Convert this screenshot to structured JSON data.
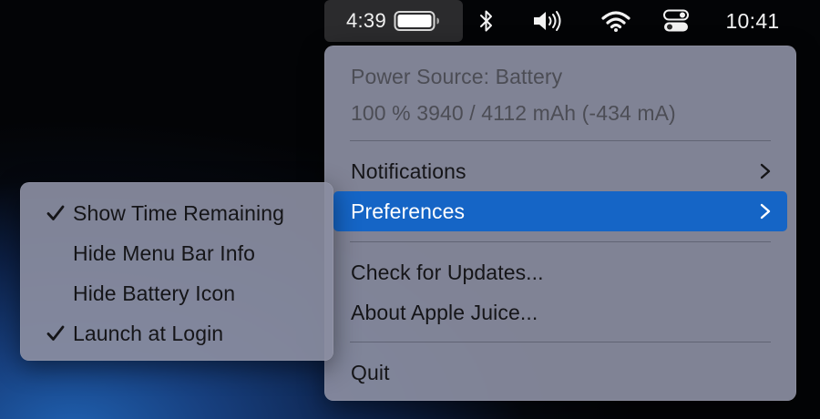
{
  "menubar": {
    "battery_time": "4:39",
    "battery_level_percent": 100,
    "clock": "10:41",
    "icons": [
      "battery-icon",
      "bluetooth-icon",
      "volume-icon",
      "wifi-icon",
      "control-center-icon"
    ]
  },
  "main_menu": {
    "power_source": "Power Source: Battery",
    "capacity": "100 % 3940 / 4112 mAh (-434 mA)",
    "notifications": "Notifications",
    "preferences": "Preferences",
    "check_updates": "Check for Updates...",
    "about": "About Apple Juice...",
    "quit": "Quit"
  },
  "preferences_submenu": {
    "items": [
      {
        "label": "Show Time Remaining",
        "checked": true
      },
      {
        "label": "Hide Menu Bar Info",
        "checked": false
      },
      {
        "label": "Hide Battery Icon",
        "checked": false
      },
      {
        "label": "Launch at Login",
        "checked": true
      }
    ]
  },
  "colors": {
    "highlight": "#1565c6",
    "menu_background": "#8a8da0",
    "battery_extra_background": "#2b2b2d"
  }
}
